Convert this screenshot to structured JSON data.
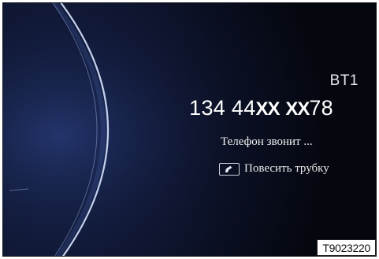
{
  "screen": {
    "device_label": "BT1",
    "phone_number_prefix": "134 44",
    "phone_number_masked_1": "XX",
    "phone_number_masked_2": "XX",
    "phone_number_suffix": "78",
    "status_text": "Телефон звонит ...",
    "hangup_label": "Повесить трубку",
    "hangup_icon": "phone-hangup-icon"
  },
  "figure_code": "T9023220",
  "colors": {
    "background": "#0a0f22",
    "arc_highlight": "#cfe0ff",
    "text": "#ffffff"
  }
}
